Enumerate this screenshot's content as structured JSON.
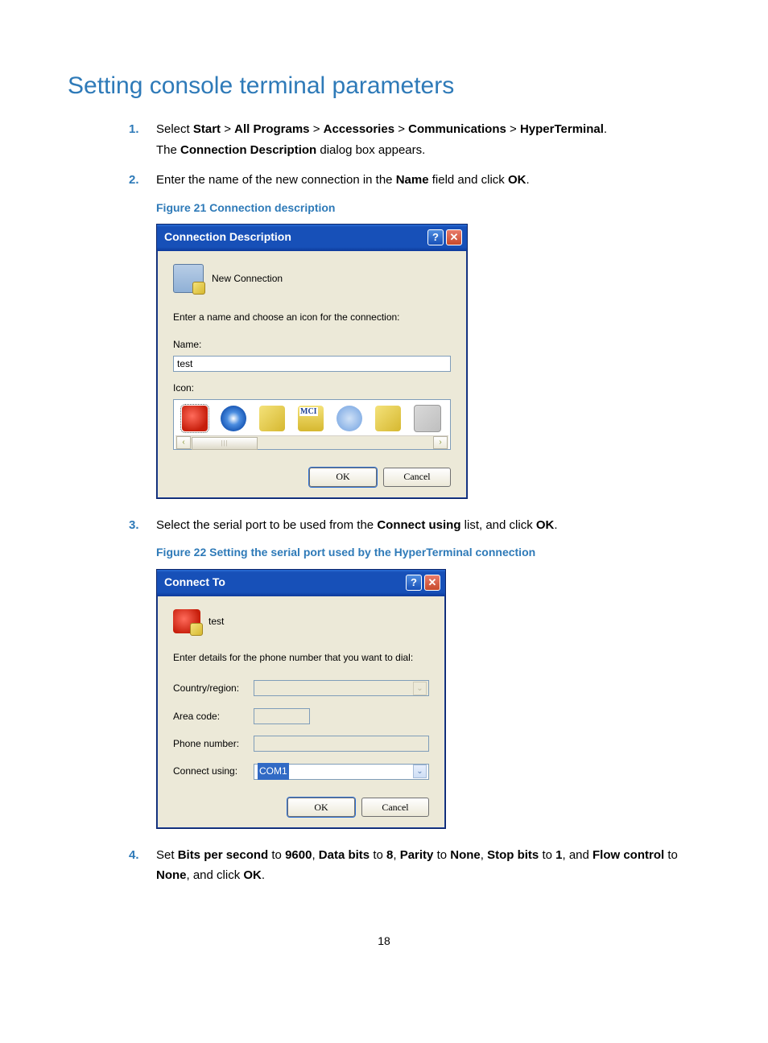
{
  "heading": "Setting console terminal parameters",
  "steps": {
    "s1": {
      "num": "1.",
      "prefix": "Select ",
      "path": [
        "Start",
        "All Programs",
        "Accessories",
        "Communications",
        "HyperTerminal"
      ],
      "sep": " > ",
      "suffix": ".",
      "line2a": "The ",
      "line2b": "Connection Description",
      "line2c": " dialog box appears."
    },
    "s2": {
      "num": "2.",
      "a": "Enter the name of the new connection in the ",
      "b": "Name",
      "c": " field and click ",
      "d": "OK",
      "e": "."
    },
    "fig21": "Figure 21 Connection description",
    "s3": {
      "num": "3.",
      "a": "Select the serial port to be used from the ",
      "b": "Connect using",
      "c": " list, and click ",
      "d": "OK",
      "e": "."
    },
    "fig22": "Figure 22 Setting the serial port used by the HyperTerminal connection",
    "s4": {
      "num": "4.",
      "parts": [
        {
          "t": "Set ",
          "b": 0
        },
        {
          "t": "Bits per second",
          "b": 1
        },
        {
          "t": " to ",
          "b": 0
        },
        {
          "t": "9600",
          "b": 1
        },
        {
          "t": ", ",
          "b": 0
        },
        {
          "t": "Data bits",
          "b": 1
        },
        {
          "t": " to ",
          "b": 0
        },
        {
          "t": "8",
          "b": 1
        },
        {
          "t": ", ",
          "b": 0
        },
        {
          "t": "Parity",
          "b": 1
        },
        {
          "t": " to ",
          "b": 0
        },
        {
          "t": "None",
          "b": 1
        },
        {
          "t": ", ",
          "b": 0
        },
        {
          "t": "Stop bits",
          "b": 1
        },
        {
          "t": " to ",
          "b": 0
        },
        {
          "t": "1",
          "b": 1
        },
        {
          "t": ", and ",
          "b": 0
        },
        {
          "t": "Flow control",
          "b": 1
        },
        {
          "t": " to ",
          "b": 0
        },
        {
          "t": "None",
          "b": 1
        },
        {
          "t": ", and click ",
          "b": 0
        },
        {
          "t": "OK",
          "b": 1
        },
        {
          "t": ".",
          "b": 0
        }
      ]
    }
  },
  "dlg1": {
    "title": "Connection Description",
    "icon_label": "New Connection",
    "prompt": "Enter a name and choose an icon for the connection:",
    "name_label": "Name:",
    "name_value": "test",
    "icon_label2": "Icon:",
    "ok": "OK",
    "cancel": "Cancel"
  },
  "dlg2": {
    "title": "Connect To",
    "icon_label": "test",
    "prompt": "Enter details for the phone number that you want to dial:",
    "country_label": "Country/region:",
    "country_value": "",
    "area_label": "Area code:",
    "area_value": "",
    "phone_label": "Phone number:",
    "phone_value": "",
    "connect_label": "Connect using:",
    "connect_value": "COM1",
    "ok": "OK",
    "cancel": "Cancel"
  },
  "page_number": "18"
}
